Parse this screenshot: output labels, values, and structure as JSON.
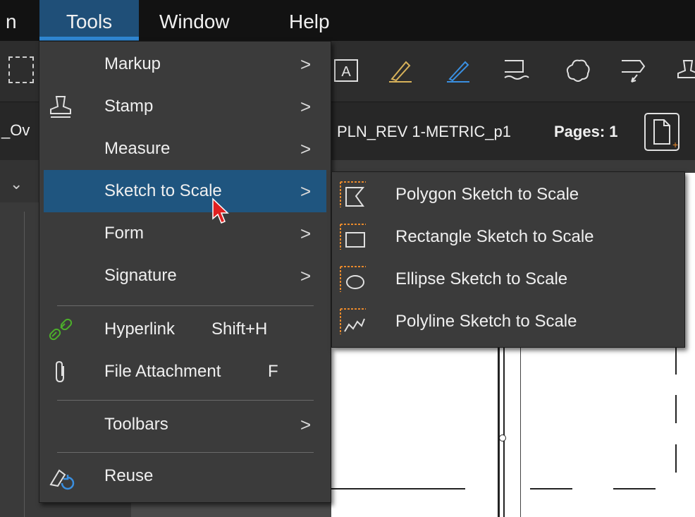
{
  "menubar": {
    "partial_left": "n",
    "items": [
      "Tools",
      "Window",
      "Help"
    ]
  },
  "tabbar": {
    "partial_left": "_Ov",
    "doc_title": "PLN_REV 1-METRIC_p1",
    "pages_label": "Pages: 1"
  },
  "tools_menu": {
    "items": [
      {
        "label": "Markup",
        "icon": "none",
        "has_submenu": true
      },
      {
        "label": "Stamp",
        "icon": "stamp-icon",
        "has_submenu": true
      },
      {
        "label": "Measure",
        "icon": "none",
        "has_submenu": true
      },
      {
        "label": "Sketch to Scale",
        "icon": "none",
        "has_submenu": true,
        "highlighted": true
      },
      {
        "label": "Form",
        "icon": "none",
        "has_submenu": true
      },
      {
        "label": "Signature",
        "icon": "none",
        "has_submenu": true
      },
      {
        "label": "Hyperlink",
        "shortcut": "Shift+H",
        "icon": "link-icon",
        "icon_color": "#4caf2a"
      },
      {
        "label": "File Attachment",
        "shortcut": "F",
        "icon": "paperclip-icon"
      },
      {
        "label": "Toolbars",
        "icon": "none",
        "has_submenu": true
      },
      {
        "label": "Reuse",
        "icon": "reuse-icon"
      }
    ],
    "chevron": ">"
  },
  "sketch_submenu": {
    "items": [
      {
        "label": "Polygon Sketch to Scale",
        "icon": "polygon-sketch-icon"
      },
      {
        "label": "Rectangle Sketch to Scale",
        "icon": "rectangle-sketch-icon"
      },
      {
        "label": "Ellipse Sketch to Scale",
        "icon": "ellipse-sketch-icon"
      },
      {
        "label": "Polyline Sketch to Scale",
        "icon": "polyline-sketch-icon"
      }
    ],
    "icon_accent": "#e8892b"
  },
  "colors": {
    "menubar_bg": "#121212",
    "menu_bg": "#3b3b3b",
    "highlight": "#1f557f",
    "accent_blue": "#2f86d1"
  }
}
